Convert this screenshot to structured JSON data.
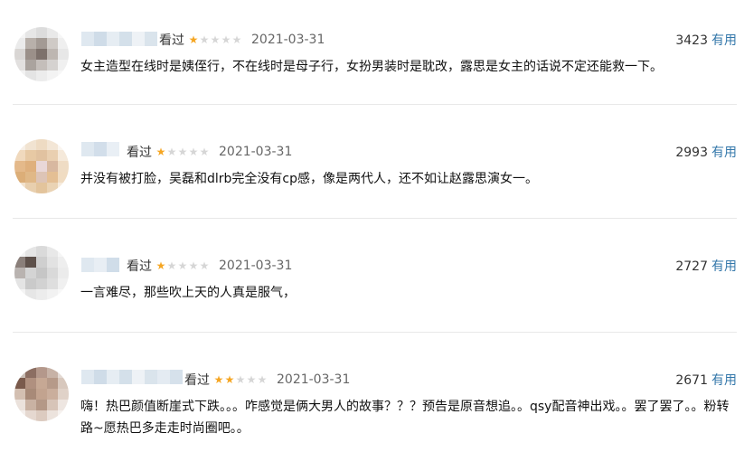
{
  "reviews": [
    {
      "status": "看过",
      "rating": 1,
      "date": "2021-03-31",
      "votes": "3423",
      "useful_label": "有用",
      "content": "女主造型在线时是姨侄行，不在线时是母子行，女扮男装时是耽改，露思是女主的话说不定还能救一下。"
    },
    {
      "status": "看过",
      "rating": 1,
      "date": "2021-03-31",
      "votes": "2993",
      "useful_label": "有用",
      "content": "并没有被打脸，吴磊和dlrb完全没有cp感，像是两代人，还不如让赵露思演女一。"
    },
    {
      "status": "看过",
      "rating": 1,
      "date": "2021-03-31",
      "votes": "2727",
      "useful_label": "有用",
      "content": "一言难尽，那些吹上天的人真是服气，"
    },
    {
      "status": "看过",
      "rating": 2,
      "date": "2021-03-31",
      "votes": "2671",
      "useful_label": "有用",
      "content": "嗨！热巴颜值断崖式下跌。。。咋感觉是俩大男人的故事？？？预告是原音想追。。qsy配音神出戏。。罢了罢了。。粉转路~愿热巴多走走时尚圈吧。。"
    }
  ],
  "colors": {
    "star_on": "#f5a623",
    "star_off": "#d6d6d6",
    "link": "#3377aa",
    "divider": "#e8e8e8"
  }
}
